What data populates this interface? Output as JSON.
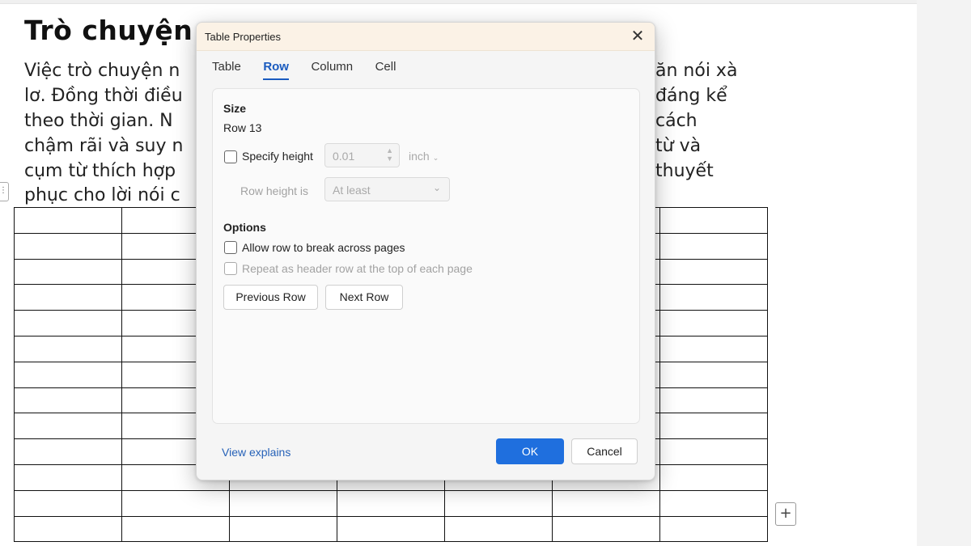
{
  "document": {
    "heading": "Trò chuyện",
    "paragraph_left": [
      "Việc trò chuyện n",
      "lơ. Đồng thời điều",
      "theo thời gian. N",
      "chậm rãi và suy n",
      "cụm từ thích hợp",
      "phục cho lời nói c"
    ],
    "paragraph_right": [
      "ăn nói xà",
      "đáng kể",
      "cách",
      "từ và",
      "thuyết",
      ""
    ],
    "table_rows": 13,
    "table_cols": 7,
    "row_handle_glyph": "⋮",
    "add_row_glyph": "+"
  },
  "dialog": {
    "title": "Table Properties",
    "close_glyph": "✕",
    "tabs": [
      "Table",
      "Row",
      "Column",
      "Cell"
    ],
    "active_tab": "Row",
    "size": {
      "title": "Size",
      "row_label": "Row 13",
      "specify_height_label": "Specify height",
      "specify_height_checked": false,
      "height_value": "0.01",
      "height_unit": "inch",
      "row_height_is_label": "Row height is",
      "row_height_mode": "At least"
    },
    "options": {
      "title": "Options",
      "allow_break_label": "Allow row to break across pages",
      "allow_break_checked": false,
      "repeat_header_label": "Repeat as header row at the top of each page",
      "repeat_header_checked": false
    },
    "previous_row_label": "Previous Row",
    "next_row_label": "Next Row",
    "view_explains_label": "View explains",
    "ok_label": "OK",
    "cancel_label": "Cancel"
  },
  "colors": {
    "accent": "#1f6fde",
    "link": "#2762b8",
    "titlebar": "#fbf2e6"
  }
}
